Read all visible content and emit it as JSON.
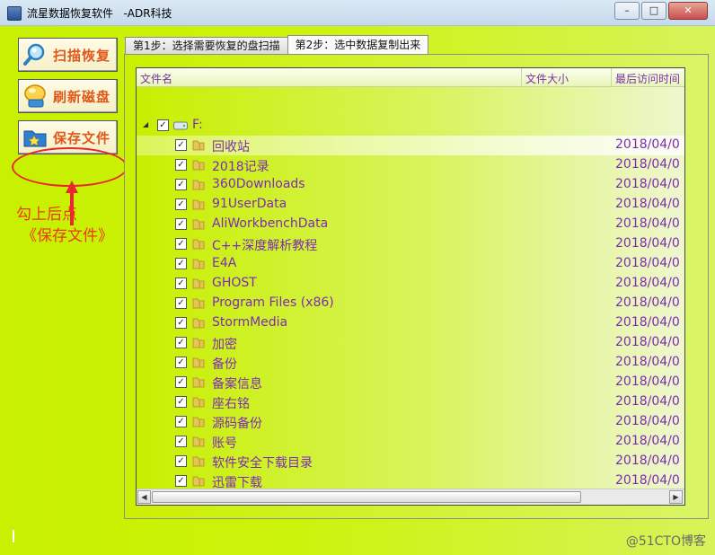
{
  "window": {
    "title": "流星数据恢复软件   -ADR科技",
    "buttons": {
      "minimize": "–",
      "maximize": "□",
      "close": "✕"
    }
  },
  "sidebar": {
    "buttons": [
      {
        "label": "扫描恢复",
        "icon": "magnifier-icon"
      },
      {
        "label": "刷新磁盘",
        "icon": "refresh-disk-icon"
      },
      {
        "label": "保存文件",
        "icon": "save-folder-icon"
      }
    ]
  },
  "annotation": {
    "line1": "勾上后点",
    "line2": "《保存文件》"
  },
  "tabs": [
    {
      "label": "第1步：选择需要恢复的盘扫描",
      "active": false
    },
    {
      "label": "第2步：选中数据复制出来",
      "active": true
    }
  ],
  "list": {
    "columns": {
      "name": "文件名",
      "size": "文件大小",
      "last_access": "最后访问时间"
    },
    "root": {
      "label": "F:",
      "checked": true
    },
    "rows": [
      {
        "name": "回收站",
        "date": "2018/04/0"
      },
      {
        "name": "2018记录",
        "date": "2018/04/0"
      },
      {
        "name": "360Downloads",
        "date": "2018/04/0"
      },
      {
        "name": "91UserData",
        "date": "2018/04/0"
      },
      {
        "name": "AliWorkbenchData",
        "date": "2018/04/0"
      },
      {
        "name": "C++深度解析教程",
        "date": "2018/04/0"
      },
      {
        "name": "E4A",
        "date": "2018/04/0"
      },
      {
        "name": "GHOST",
        "date": "2018/04/0"
      },
      {
        "name": "Program Files (x86)",
        "date": "2018/04/0"
      },
      {
        "name": "StormMedia",
        "date": "2018/04/0"
      },
      {
        "name": "加密",
        "date": "2018/04/0"
      },
      {
        "name": "备份",
        "date": "2018/04/0"
      },
      {
        "name": "备案信息",
        "date": "2018/04/0"
      },
      {
        "name": "座右铭",
        "date": "2018/04/0"
      },
      {
        "name": "源码备份",
        "date": "2018/04/0"
      },
      {
        "name": "账号",
        "date": "2018/04/0"
      },
      {
        "name": "软件安全下载目录",
        "date": "2018/04/0"
      },
      {
        "name": "迅雷下载",
        "date": "2018/04/0"
      }
    ]
  },
  "watermark": "@51CTO博客",
  "colors": {
    "accent_purple": "#7d2bb5",
    "annotation_red": "#e8282e",
    "background_green": "#c8f000"
  }
}
